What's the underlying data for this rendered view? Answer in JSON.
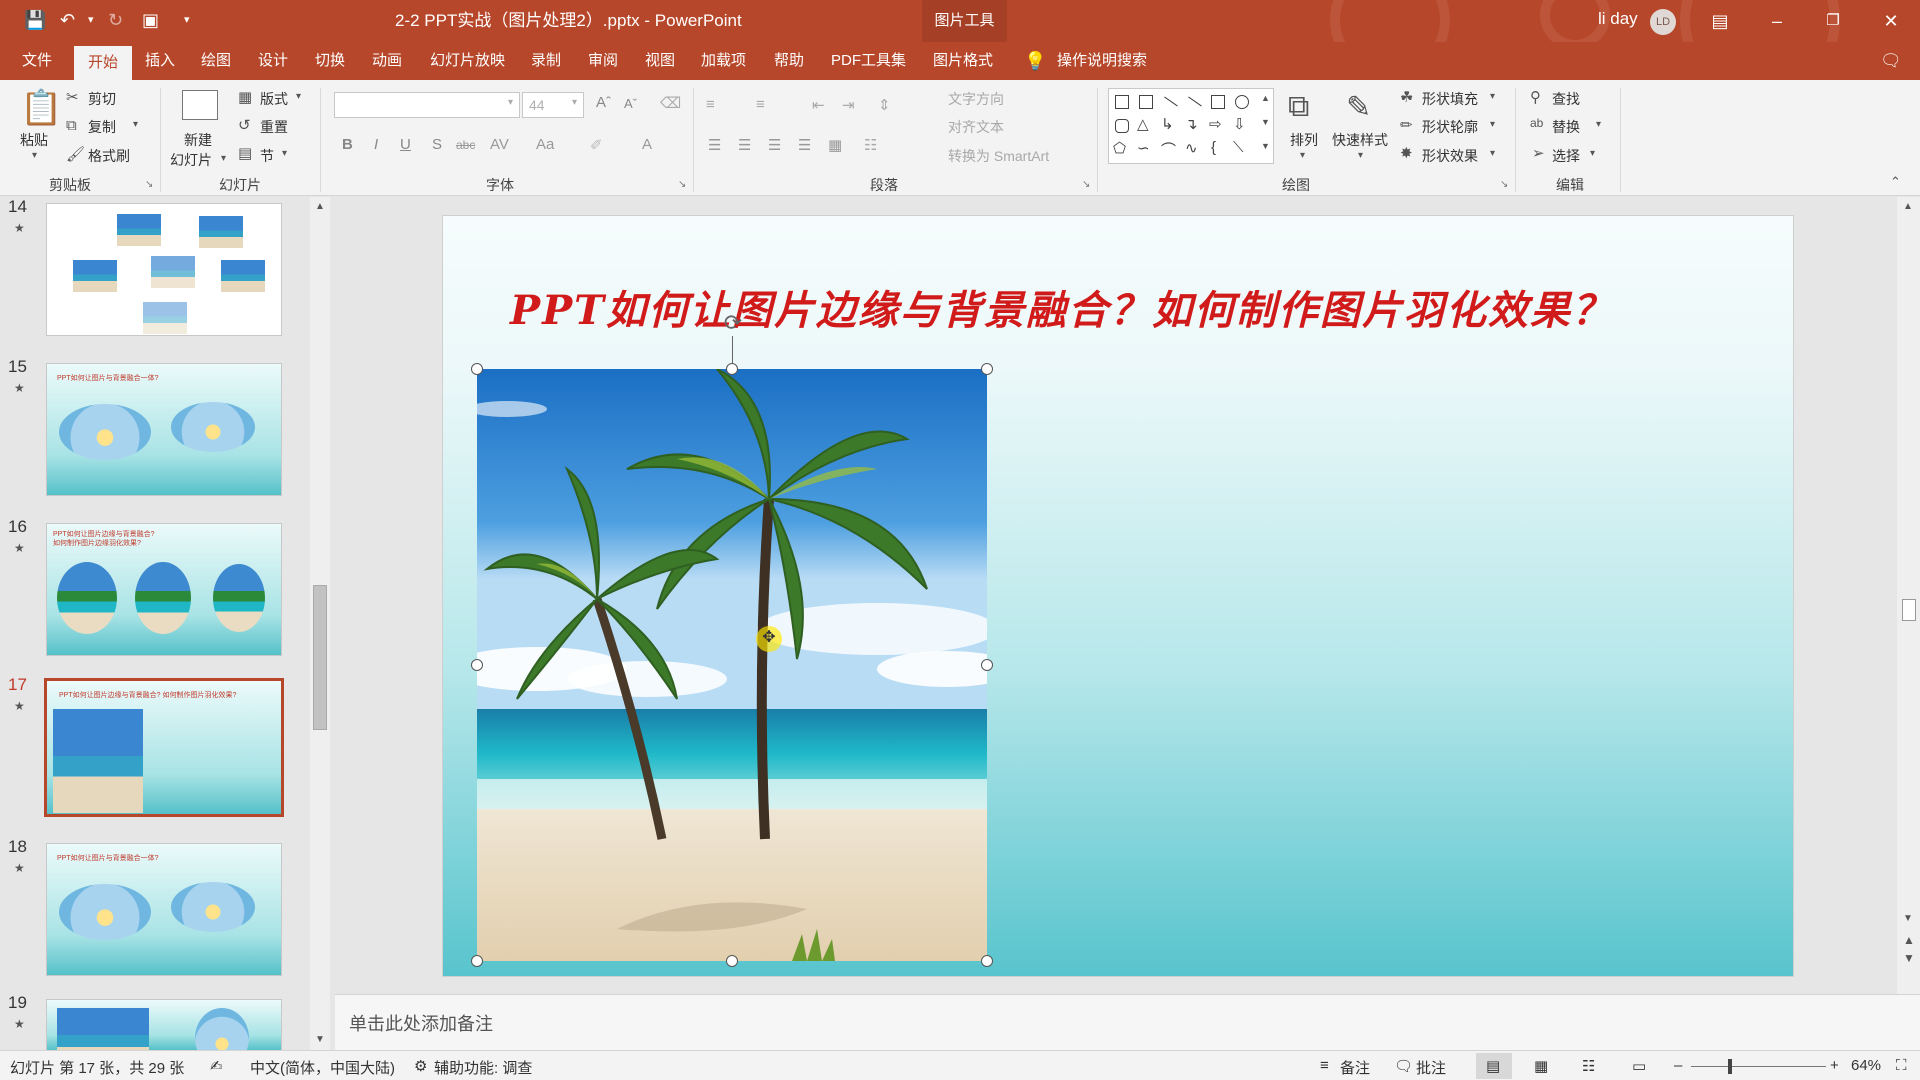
{
  "app": {
    "doc_title": "2-2 PPT实战（图片处理2）.pptx  -  PowerPoint",
    "picture_tools": "图片工具",
    "user_name": "li day",
    "user_initials": "LD"
  },
  "tabs": [
    "文件",
    "开始",
    "插入",
    "绘图",
    "设计",
    "切换",
    "动画",
    "幻灯片放映",
    "录制",
    "审阅",
    "视图",
    "加载项",
    "帮助",
    "PDF工具集",
    "图片格式"
  ],
  "active_tab": "开始",
  "tell_me": "操作说明搜索",
  "ribbon": {
    "clipboard": {
      "group": "剪贴板",
      "paste": "粘贴",
      "cut": "剪切",
      "copy": "复制",
      "format_painter": "格式刷"
    },
    "slides": {
      "group": "幻灯片",
      "new_slide_1": "新建",
      "new_slide_2": "幻灯片",
      "layout": "版式",
      "reset": "重置",
      "section": "节"
    },
    "font": {
      "group": "字体",
      "font_size": "44"
    },
    "paragraph": {
      "group": "段落",
      "text_direction": "文字方向",
      "align_text": "对齐文本",
      "smartart": "转换为 SmartArt"
    },
    "drawing": {
      "group": "绘图",
      "arrange": "排列",
      "quick_styles": "快速样式",
      "fill": "形状填充",
      "outline": "形状轮廓",
      "effects": "形状效果"
    },
    "editing": {
      "group": "编辑",
      "find": "查找",
      "replace": "替换",
      "select": "选择"
    }
  },
  "slides": [
    {
      "num": "14"
    },
    {
      "num": "15",
      "title": "PPT如何让图片与背景融合一体?"
    },
    {
      "num": "16",
      "title_1": "PPT如何让图片边缘与背景融合?",
      "title_2": "如何制作图片边缘羽化效果?"
    },
    {
      "num": "17",
      "title": "PPT如何让图片边缘与背景融合? 如何制作图片羽化效果?"
    },
    {
      "num": "18",
      "title": "PPT如何让图片与背景融合一体?"
    },
    {
      "num": "19"
    }
  ],
  "current_slide": {
    "title": "PPT如何让图片边缘与背景融合？如何制作图片羽化效果？"
  },
  "notes_placeholder": "单击此处添加备注",
  "status": {
    "slide_counter": "幻灯片 第 17 张，共 29 张",
    "language": "中文(简体，中国大陆)",
    "accessibility": "辅助功能: 调查",
    "notes": "备注",
    "comments": "批注",
    "zoom": "64%"
  },
  "colors": {
    "accent": "#b7472a",
    "title_red": "#d11a1a"
  }
}
